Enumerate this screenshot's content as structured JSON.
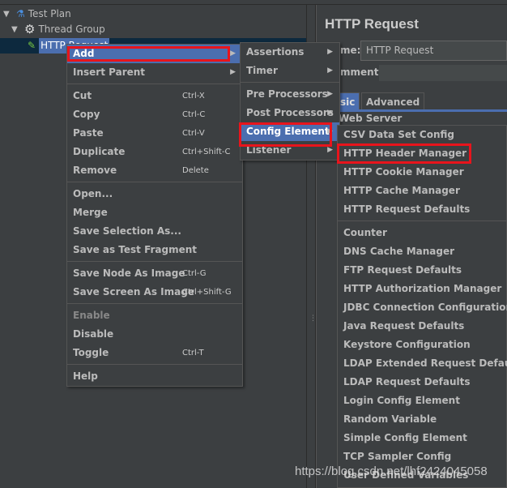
{
  "tree": {
    "items": [
      {
        "label": "Test Plan",
        "icon": "flask-icon"
      },
      {
        "label": "Thread Group",
        "icon": "gear-icon"
      },
      {
        "label": "HTTP Request",
        "icon": "pipette-icon"
      }
    ]
  },
  "panel": {
    "title": "HTTP Request",
    "name_label": "me:",
    "name_value": "HTTP Request",
    "comments_label": "mments:",
    "tabs": [
      "sic",
      "Advanced"
    ],
    "section": "Web Server"
  },
  "context_menu": {
    "groups": [
      [
        {
          "label": "Add",
          "submenu": true,
          "highlighted": true
        },
        {
          "label": "Insert Parent",
          "submenu": true
        }
      ],
      [
        {
          "label": "Cut",
          "shortcut": "Ctrl-X"
        },
        {
          "label": "Copy",
          "shortcut": "Ctrl-C"
        },
        {
          "label": "Paste",
          "shortcut": "Ctrl-V"
        },
        {
          "label": "Duplicate",
          "shortcut": "Ctrl+Shift-C"
        },
        {
          "label": "Remove",
          "shortcut": "Delete"
        }
      ],
      [
        {
          "label": "Open..."
        },
        {
          "label": "Merge"
        },
        {
          "label": "Save Selection As..."
        },
        {
          "label": "Save as Test Fragment"
        }
      ],
      [
        {
          "label": "Save Node As Image",
          "shortcut": "Ctrl-G"
        },
        {
          "label": "Save Screen As Image",
          "shortcut": "Ctrl+Shift-G"
        }
      ],
      [
        {
          "label": "Enable",
          "disabled": true
        },
        {
          "label": "Disable"
        },
        {
          "label": "Toggle",
          "shortcut": "Ctrl-T"
        }
      ],
      [
        {
          "label": "Help"
        }
      ]
    ]
  },
  "add_menu": {
    "groups": [
      [
        {
          "label": "Assertions",
          "submenu": true
        },
        {
          "label": "Timer",
          "submenu": true
        }
      ],
      [
        {
          "label": "Pre Processors",
          "submenu": true
        },
        {
          "label": "Post Processors",
          "submenu": true
        },
        {
          "label": "Config Element",
          "submenu": true,
          "highlighted": true
        },
        {
          "label": "Listener",
          "submenu": true
        }
      ]
    ]
  },
  "config_menu": {
    "groups": [
      [
        {
          "label": "CSV Data Set Config"
        },
        {
          "label": "HTTP Header Manager"
        },
        {
          "label": "HTTP Cookie Manager"
        },
        {
          "label": "HTTP Cache Manager"
        },
        {
          "label": "HTTP Request Defaults"
        }
      ],
      [
        {
          "label": "Counter"
        },
        {
          "label": "DNS Cache Manager"
        },
        {
          "label": "FTP Request Defaults"
        },
        {
          "label": "HTTP Authorization Manager"
        },
        {
          "label": "JDBC Connection Configuration"
        },
        {
          "label": "Java Request Defaults"
        },
        {
          "label": "Keystore Configuration"
        },
        {
          "label": "LDAP Extended Request Defaults"
        },
        {
          "label": "LDAP Request Defaults"
        },
        {
          "label": "Login Config Element"
        },
        {
          "label": "Random Variable"
        },
        {
          "label": "Simple Config Element"
        },
        {
          "label": "TCP Sampler Config"
        },
        {
          "label": "User Defined Variables"
        }
      ]
    ]
  },
  "watermark": "https://blog.csdn.net/lhf2424045058",
  "colors": {
    "background": "#3c3f41",
    "highlight": "#4b6eaf",
    "annotation_box": "#e8141c"
  }
}
